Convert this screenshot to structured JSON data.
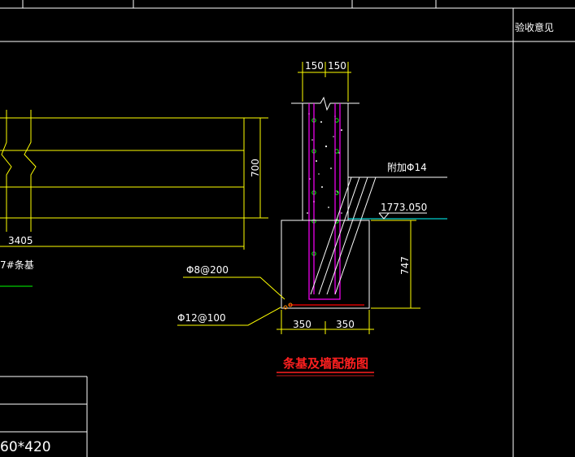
{
  "title_block": {
    "acceptance_opinion": "验收意见"
  },
  "drawing": {
    "title": "条基及墙配筋图",
    "dims": {
      "wall_half_left": "150",
      "wall_half_right": "150",
      "footing_half_left": "350",
      "footing_half_right": "350",
      "footing_height": "747",
      "beam_height": "700",
      "beam_length": "3405"
    },
    "labels": {
      "stirrup": "Φ8@200",
      "bottom_bar": "Φ12@100",
      "anchor_bar": "附加Φ14",
      "elevation": "1773.050",
      "beam_label": "7#条基",
      "table_value": "60*420"
    }
  },
  "colors": {
    "background": "#000000",
    "frame": "#ffffff",
    "dimension": "#ffff00",
    "rebar": "#ff00ff",
    "title": "#ff2020",
    "ground": "#00ffff",
    "leader": "#ffff00"
  }
}
